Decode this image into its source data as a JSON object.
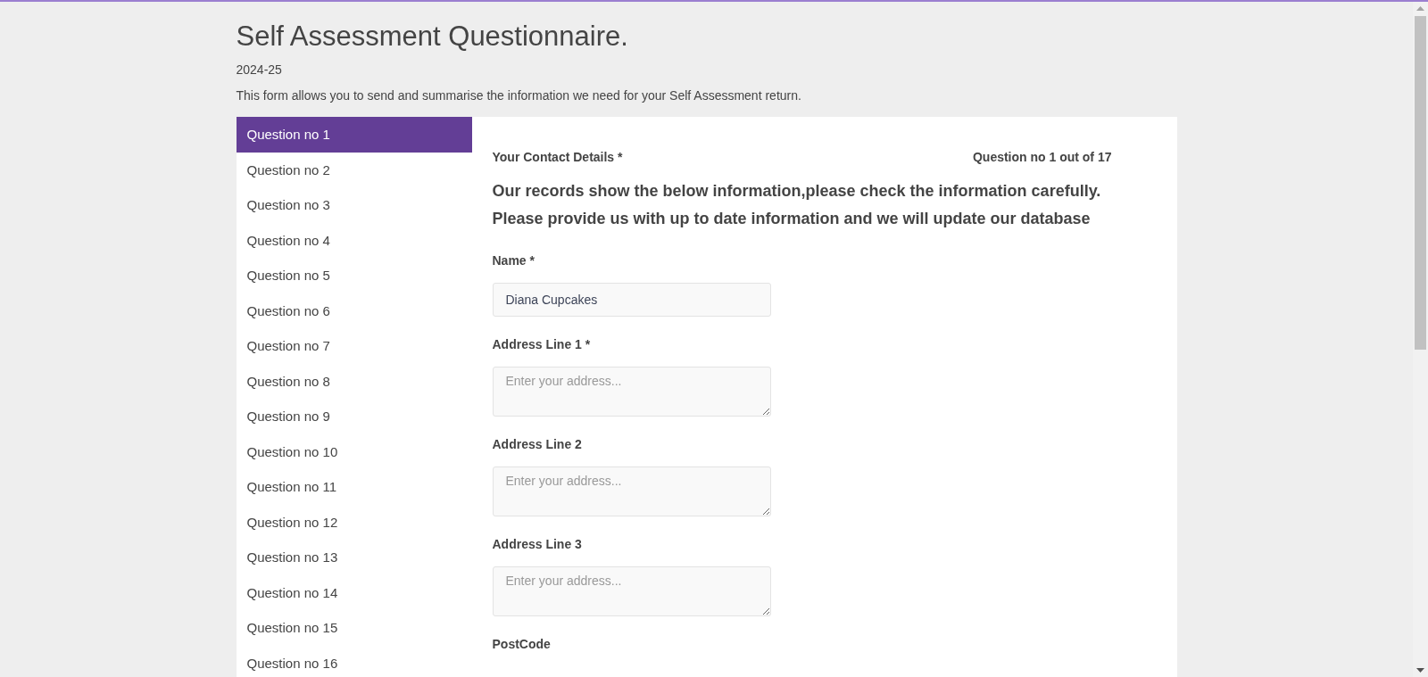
{
  "page": {
    "title": "Self Assessment Questionnaire.",
    "year": "2024-25",
    "description": "This form allows you to send and summarise the information we need for your Self Assessment return."
  },
  "sidebar": {
    "items": [
      {
        "label": "Question no 1",
        "selected": true
      },
      {
        "label": "Question no 2",
        "selected": false
      },
      {
        "label": "Question no 3",
        "selected": false
      },
      {
        "label": "Question no 4",
        "selected": false
      },
      {
        "label": "Question no 5",
        "selected": false
      },
      {
        "label": "Question no 6",
        "selected": false
      },
      {
        "label": "Question no 7",
        "selected": false
      },
      {
        "label": "Question no 8",
        "selected": false
      },
      {
        "label": "Question no 9",
        "selected": false
      },
      {
        "label": "Question no 10",
        "selected": false
      },
      {
        "label": "Question no 11",
        "selected": false
      },
      {
        "label": "Question no 12",
        "selected": false
      },
      {
        "label": "Question no 13",
        "selected": false
      },
      {
        "label": "Question no 14",
        "selected": false
      },
      {
        "label": "Question no 15",
        "selected": false
      },
      {
        "label": "Question no 16",
        "selected": false
      }
    ]
  },
  "question": {
    "section": "Your Contact Details *",
    "progress": "Question no 1 out of 17",
    "intro": [
      "Our records show the below information,please check the information carefully.",
      "Please provide us with up to date information and we will update our database"
    ],
    "fields": [
      {
        "kind": "input",
        "label": "Name *",
        "value": "Diana Cupcakes"
      },
      {
        "kind": "textarea",
        "label": "Address Line 1 *",
        "placeholder": "Enter your address..."
      },
      {
        "kind": "textarea",
        "label": "Address Line 2",
        "placeholder": "Enter your address..."
      },
      {
        "kind": "textarea",
        "label": "Address Line 3",
        "placeholder": "Enter your address..."
      },
      {
        "kind": "label",
        "label": "PostCode"
      }
    ]
  }
}
